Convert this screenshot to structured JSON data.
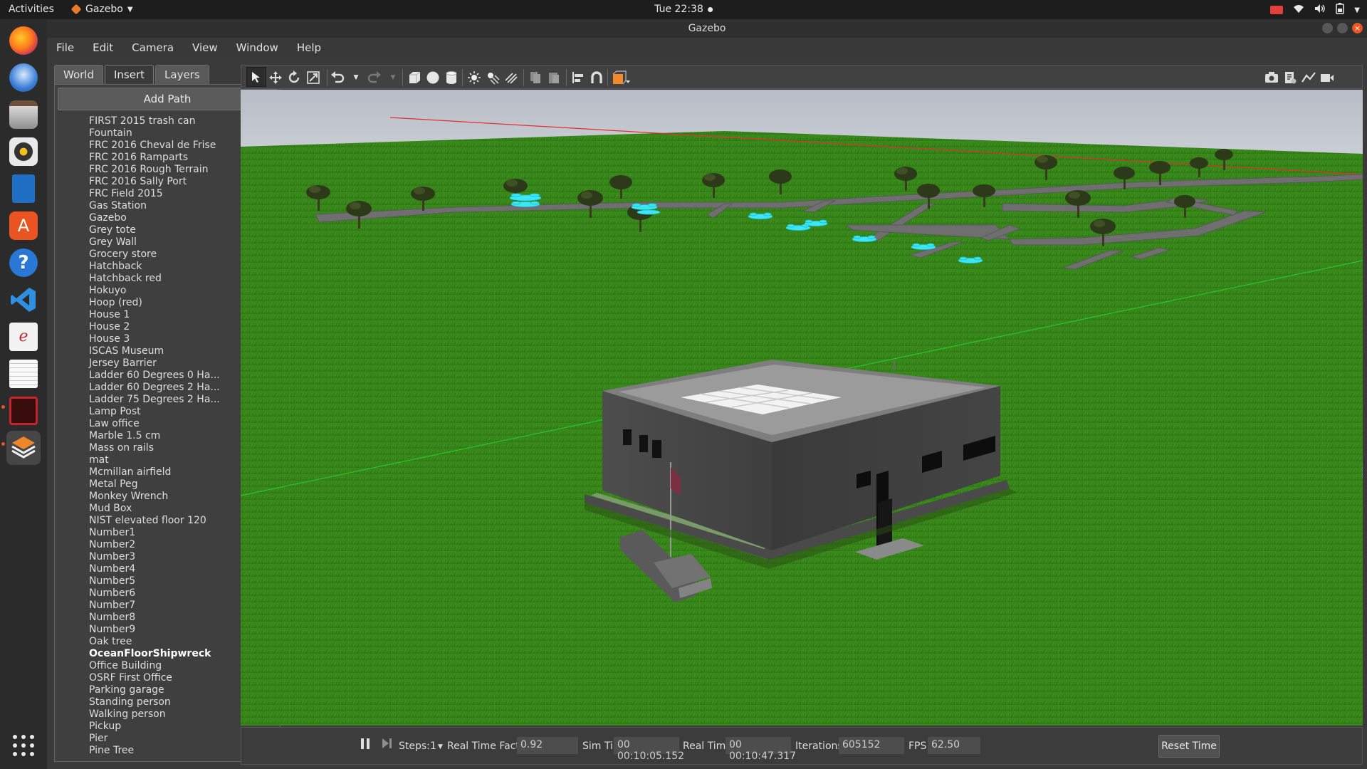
{
  "topbar": {
    "activities": "Activities",
    "app_name": "Gazebo",
    "clock": "Tue 22:38",
    "tray_icons": [
      "record-icon",
      "wifi-icon",
      "volume-icon",
      "battery-icon",
      "caret-down-icon"
    ]
  },
  "window": {
    "title": "Gazebo"
  },
  "menubar": {
    "items": [
      "File",
      "Edit",
      "Camera",
      "View",
      "Window",
      "Help"
    ]
  },
  "tabs": [
    "World",
    "Insert",
    "Layers"
  ],
  "insert": {
    "add_path": "Add Path",
    "models": [
      "FIRST 2015 trash can",
      "Fountain",
      "FRC 2016 Cheval de Frise",
      "FRC 2016 Ramparts",
      "FRC 2016 Rough Terrain",
      "FRC 2016 Sally Port",
      "FRC Field 2015",
      "Gas Station",
      "Gazebo",
      "Grey tote",
      "Grey Wall",
      "Grocery store",
      "Hatchback",
      "Hatchback red",
      "Hokuyo",
      "Hoop (red)",
      "House 1",
      "House 2",
      "House 3",
      "ISCAS Museum",
      "Jersey Barrier",
      "Ladder 60 Degrees 0 Ha...",
      "Ladder 60 Degrees 2 Ha...",
      "Ladder 75 Degrees 2 Ha...",
      "Lamp Post",
      "Law office",
      "Marble 1.5 cm",
      "Mass on rails",
      "mat",
      "Mcmillan airfield",
      "Metal Peg",
      "Monkey Wrench",
      "Mud Box",
      "NIST elevated floor 120",
      "Number1",
      "Number2",
      "Number3",
      "Number4",
      "Number5",
      "Number6",
      "Number7",
      "Number8",
      "Number9",
      "Oak tree",
      "OceanFloorShipwreck",
      "Office Building",
      "OSRF First Office",
      "Parking garage",
      "Standing person",
      "Walking person",
      "Pickup",
      "Pier",
      "Pine Tree"
    ],
    "selected": "OceanFloorShipwreck"
  },
  "toolbar": {
    "tools": [
      "select-icon",
      "translate-icon",
      "rotate-icon",
      "scale-icon",
      "undo-icon",
      "undo-dropdown-icon",
      "redo-icon",
      "redo-dropdown-icon",
      "box-icon",
      "sphere-icon",
      "cylinder-icon",
      "point-light-icon",
      "spot-light-icon",
      "directional-light-icon",
      "copy-icon",
      "paste-icon",
      "align-icon",
      "snap-icon",
      "view-angle-icon"
    ],
    "right_tools": [
      "screenshot-icon",
      "log-icon",
      "plot-icon",
      "record-video-icon"
    ]
  },
  "bottombar": {
    "steps_label": "Steps:",
    "steps_value": "1",
    "rtf_label": "Real Time Factor:",
    "rtf_value": "0.92",
    "sim_time_label": "Sim Time:",
    "sim_time_value": "00 00:10:05.152",
    "real_time_label": "Real Time:",
    "real_time_value": "00 00:10:47.317",
    "iterations_label": "Iterations:",
    "iterations_value": "605152",
    "fps_label": "FPS:",
    "fps_value": "62.50",
    "reset_label": "Reset Time"
  },
  "colors": {
    "accent": "#e95420",
    "grass": "#3f8f1e",
    "sky": "#c9cdd4",
    "drone": "#35e6f2"
  }
}
